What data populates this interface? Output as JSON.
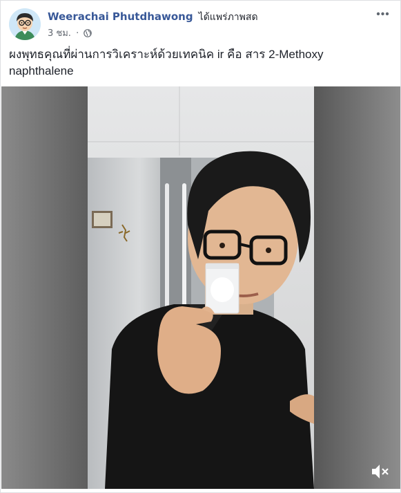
{
  "post": {
    "author": {
      "name": "Weerachai Phutdhawong",
      "action": "ได้แพร่ภาพสด",
      "avatar_icon": "cartoon-avatar-icon"
    },
    "timestamp": "3 ชม.",
    "separator": "·",
    "privacy_icon": "globe-icon",
    "more_icon": "more-horizontal-icon",
    "caption": "ผงพุทธคุณที่ผ่านการวิเคราะห์ด้วยเทคนิค ir คือ สาร 2-Methoxy\nnaphthalene"
  },
  "video": {
    "mute_icon": "speaker-muted-icon"
  },
  "colors": {
    "link": "#385898",
    "text": "#1d2129",
    "secondary": "#616770",
    "border": "#dddfe2"
  }
}
